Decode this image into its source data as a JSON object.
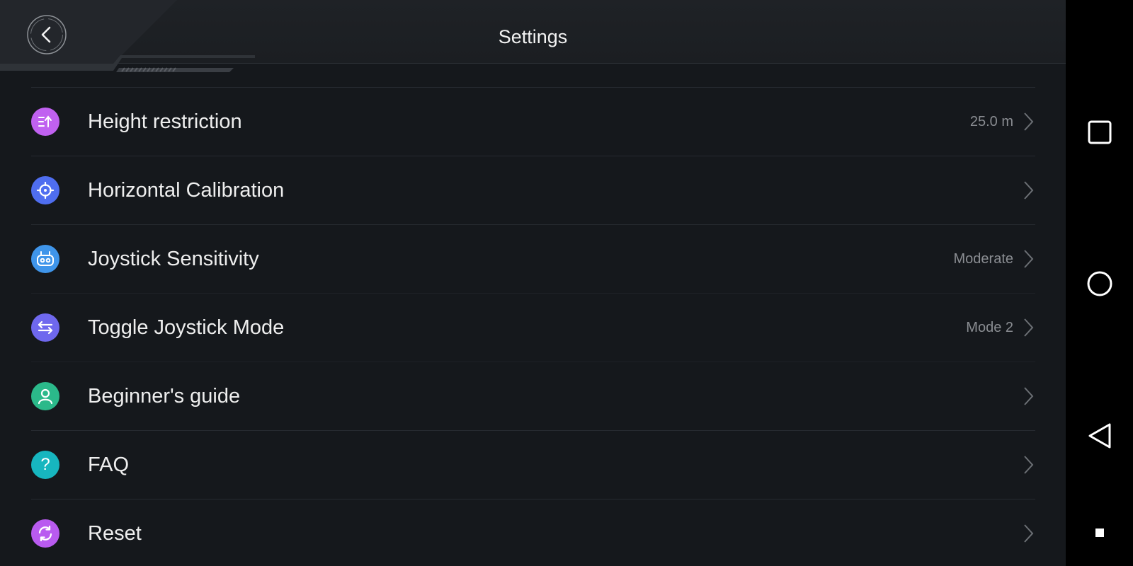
{
  "header": {
    "title": "Settings",
    "back_icon": "chevron-left-icon"
  },
  "settings": [
    {
      "name": "height-restriction",
      "label": "Height restriction",
      "value": "25.0 m",
      "icon": "height-limit-icon",
      "color": "#c061f0"
    },
    {
      "name": "horizontal-calibration",
      "label": "Horizontal Calibration",
      "value": "",
      "icon": "crosshair-icon",
      "color": "#4f6ef0"
    },
    {
      "name": "joystick-sensitivity",
      "label": "Joystick Sensitivity",
      "value": "Moderate",
      "icon": "controller-icon",
      "color": "#3f95ea"
    },
    {
      "name": "toggle-joystick-mode",
      "label": "Toggle Joystick Mode",
      "value": "Mode 2",
      "icon": "swap-arrows-icon",
      "color": "#6f68ee"
    },
    {
      "name": "beginners-guide",
      "label": "Beginner's guide",
      "value": "",
      "icon": "user-icon",
      "color": "#2bb98a"
    },
    {
      "name": "faq",
      "label": "FAQ",
      "value": "",
      "icon": "question-icon",
      "color": "#17b6bf"
    },
    {
      "name": "reset",
      "label": "Reset",
      "value": "",
      "icon": "refresh-icon",
      "color": "#b95bf0"
    }
  ],
  "navbar": {
    "recents_icon": "square-icon",
    "home_icon": "circle-icon",
    "back_icon": "triangle-back-icon",
    "extra_icon": "small-square-icon"
  },
  "colors": {
    "background": "#15181c",
    "header": "#1e2125",
    "divider": "#262a30",
    "value_text": "#8a8d92"
  }
}
